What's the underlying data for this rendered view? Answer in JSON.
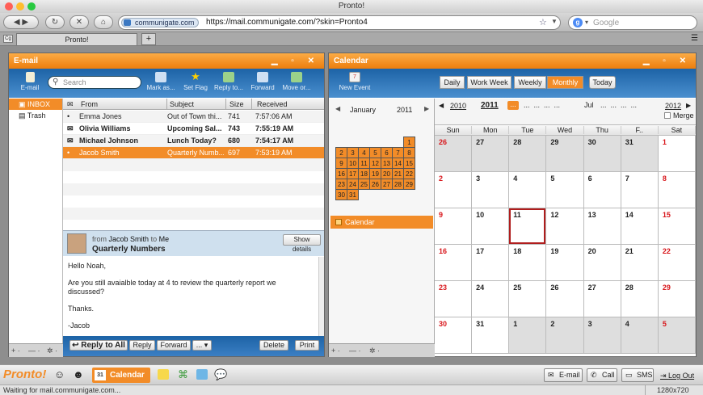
{
  "window": {
    "title": "Pronto!",
    "lights": [
      "#ff5f57",
      "#ffbd2e",
      "#28c940"
    ]
  },
  "browser": {
    "domain_badge": "communigate.com",
    "url": "https://mail.communigate.com/?skin=Pronto4",
    "search_placeholder": "Google",
    "tab_title": "Pronto!",
    "new_tab": "+"
  },
  "email": {
    "title": "E-mail",
    "toolbar": [
      "E-mail",
      "Mark as...",
      "Set Flag",
      "Reply to...",
      "Forward",
      "Move or..."
    ],
    "search_placeholder": "Search",
    "folders": [
      {
        "name": "INBOX",
        "selected": true
      },
      {
        "name": "Trash",
        "selected": false
      }
    ],
    "columns": {
      "from": "From",
      "subject": "Subject",
      "size": "Size",
      "received": "Received"
    },
    "messages": [
      {
        "from": "Emma Jones",
        "subject": "Out of Town thi...",
        "size": "741",
        "received": "7:57:06 AM",
        "unread": false,
        "selected": false
      },
      {
        "from": "Olivia Williams",
        "subject": "Upcoming Sal...",
        "size": "743",
        "received": "7:55:19 AM",
        "unread": true,
        "selected": false
      },
      {
        "from": "Michael Johnson",
        "subject": "Lunch Today?",
        "size": "680",
        "received": "7:54:17 AM",
        "unread": true,
        "selected": false
      },
      {
        "from": "Jacob Smith",
        "subject": "Quarterly Numb...",
        "size": "697",
        "received": "7:53:19 AM",
        "unread": false,
        "selected": true
      }
    ],
    "preview": {
      "from_label": "from",
      "from_name": "Jacob Smith",
      "to_label": "to",
      "to_name": "Me",
      "subject": "Quarterly Numbers",
      "show_details": "Show details",
      "body": [
        "Hello Noah,",
        "Are you still avaialble today at 4 to review the quarterly report we discussed?",
        "Thanks.",
        "-Jacob"
      ],
      "actions": [
        "Reply to All",
        "Reply",
        "Forward",
        "...",
        "Delete",
        "Print"
      ]
    },
    "footer": [
      "+ ·",
      "— ·",
      "✲ ·"
    ]
  },
  "calendar": {
    "title": "Calendar",
    "new_event": "New Event",
    "views": [
      "Daily",
      "Work Week",
      "Weekly",
      "Monthly",
      "Today"
    ],
    "active_view": "Monthly",
    "mini": {
      "month": "January",
      "year": "2011",
      "weeks": [
        [
          "",
          "",
          "",
          "",
          "",
          "",
          "1"
        ],
        [
          "2",
          "3",
          "4",
          "5",
          "6",
          "7",
          "8"
        ],
        [
          "9",
          "10",
          "11",
          "12",
          "13",
          "14",
          "15"
        ],
        [
          "16",
          "17",
          "18",
          "19",
          "20",
          "21",
          "22"
        ],
        [
          "23",
          "24",
          "25",
          "26",
          "27",
          "28",
          "29"
        ],
        [
          "30",
          "31",
          "",
          "",
          "",
          "",
          ""
        ]
      ]
    },
    "calendars": [
      "Calendar"
    ],
    "nav": {
      "prev_year": "2010",
      "year": "2011",
      "next_year": "2012",
      "mid": "Jul",
      "dots": "..."
    },
    "merge_label": "Merge",
    "days": [
      "Sun",
      "Mon",
      "Tue",
      "Wed",
      "Thu",
      "F..",
      "Sat"
    ],
    "grid": [
      [
        "26",
        "27",
        "28",
        "29",
        "30",
        "31",
        "1"
      ],
      [
        "2",
        "3",
        "4",
        "5",
        "6",
        "7",
        "8"
      ],
      [
        "9",
        "10",
        "11",
        "12",
        "13",
        "14",
        "15"
      ],
      [
        "16",
        "17",
        "18",
        "19",
        "20",
        "21",
        "22"
      ],
      [
        "23",
        "24",
        "25",
        "26",
        "27",
        "28",
        "29"
      ],
      [
        "30",
        "31",
        "1",
        "2",
        "3",
        "4",
        "5"
      ]
    ],
    "today": "11",
    "footer": [
      "+ ·",
      "— ·",
      "✲ ·"
    ]
  },
  "dock": {
    "logo": "Pronto!",
    "calendar_tab": "Calendar",
    "calendar_day": "31",
    "email": "E-mail",
    "call": "Call",
    "sms": "SMS",
    "logout": "Log Out"
  },
  "status": {
    "text": "Waiting for mail.communigate.com...",
    "resolution": "1280x720"
  },
  "colors": {
    "accent": "#f28c28",
    "toolbar_blue": "#1d63a6",
    "weekend_red": "#d8161b"
  }
}
